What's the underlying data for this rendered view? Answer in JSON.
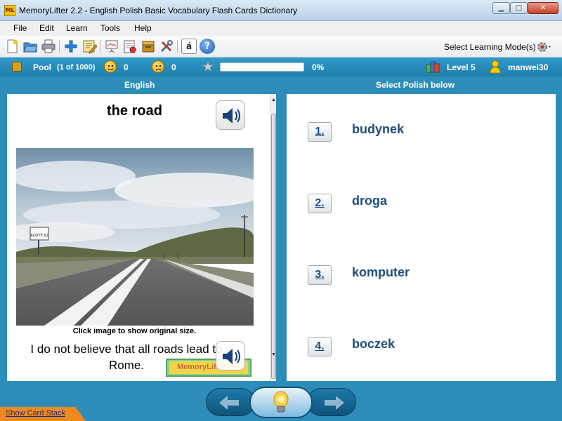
{
  "window": {
    "app_icon_text": "ML",
    "title": "MemoryLifter 2.2 - English Polish Basic Vocabulary Flash Cards Dictionary"
  },
  "menu": [
    "File",
    "Edit",
    "Learn",
    "Tools",
    "Help"
  ],
  "toolbar": {
    "icons": [
      "new-file-icon",
      "open-folder-icon",
      "print-icon",
      "add-card-icon",
      "edit-card-icon",
      "slideshow-icon",
      "dictionary-icon",
      "box-icon",
      "tools-icon",
      "character-map-icon",
      "help-icon"
    ],
    "character_map_glyph": "á",
    "help_glyph": "?",
    "learning_mode_label": "Select Learning Mode(s)"
  },
  "status": {
    "pool_label": "Pool",
    "pool_count": "(1 of 1000)",
    "correct_count": "0",
    "wrong_count": "0",
    "progress_percent": 0,
    "progress_label": "0%",
    "level": "Level 5",
    "user": "manwei30"
  },
  "question_panel": {
    "header": "English",
    "word": "the road",
    "image_caption": "Click image to show original size.",
    "image_sign_text": "ROUTE 62",
    "example_sentence": "I do not believe that all roads lead to Rome.",
    "watermark_text": "MemoryLifter"
  },
  "answer_panel": {
    "header": "Select Polish below",
    "options": [
      {
        "number": "1.",
        "text": "budynek"
      },
      {
        "number": "2.",
        "text": "droga"
      },
      {
        "number": "3.",
        "text": "komputer"
      },
      {
        "number": "4.",
        "text": "boczek"
      }
    ]
  },
  "bottom": {
    "show_card_stack": "Show Card Stack"
  },
  "colors": {
    "background": "#2e8db8",
    "answer_text": "#1f4e79",
    "stack_tab": "#f08a1c"
  }
}
